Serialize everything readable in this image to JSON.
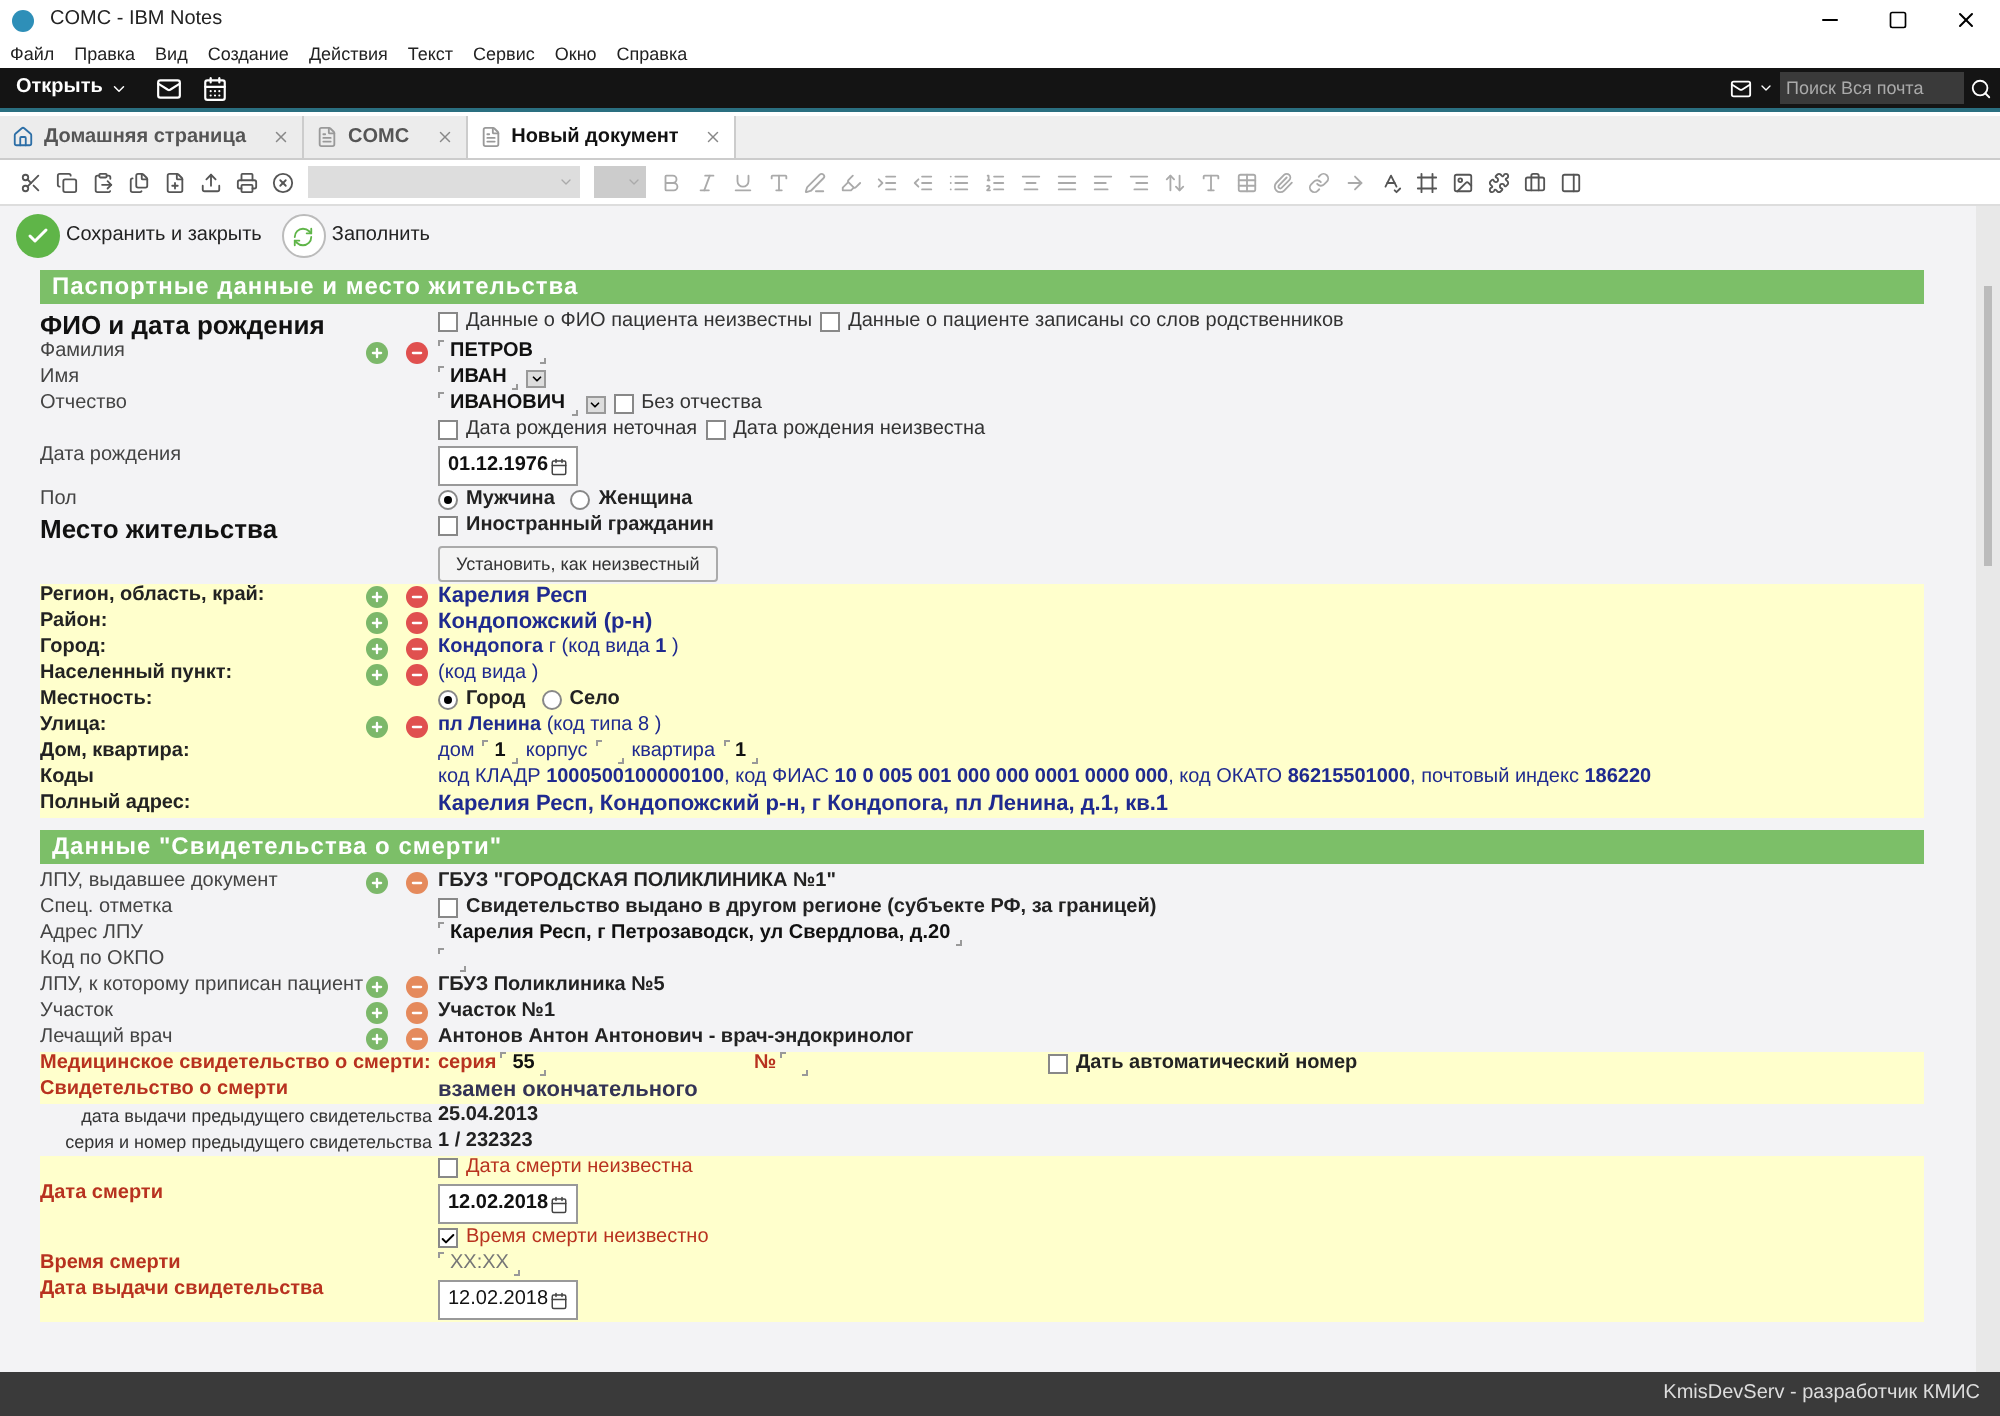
{
  "window": {
    "title": "COMC - IBM Notes"
  },
  "menu": [
    "Файл",
    "Правка",
    "Вид",
    "Создание",
    "Действия",
    "Текст",
    "Сервис",
    "Окно",
    "Справка"
  ],
  "topbar": {
    "open_label": "Открыть",
    "search_placeholder": "Поиск Вся почта"
  },
  "tabs": [
    {
      "label": "Домашняя страница",
      "kind": "home",
      "selected": false
    },
    {
      "label": "COMC",
      "kind": "doc",
      "selected": false
    },
    {
      "label": "Новый документ",
      "kind": "doc",
      "selected": true
    }
  ],
  "actions": [
    {
      "label": "Сохранить и закрыть",
      "kind": "save"
    },
    {
      "label": "Заполнить",
      "kind": "refresh"
    }
  ],
  "form": {
    "sections": [
      {
        "title": "Паспортные данные и место жительства",
        "rows": [
          {
            "kind": "heading",
            "label": "ФИО и дата рождения",
            "items": [
              {
                "kind": "checkbox",
                "label": "Данные о ФИО пациента неизвестны",
                "checked": false
              },
              {
                "kind": "checkbox",
                "label": "Данные о пациенте записаны со слов родственников",
                "checked": false
              }
            ]
          },
          {
            "kind": "field",
            "label": "Фамилия",
            "buttons": true,
            "items": [
              {
                "kind": "field",
                "value": "ПЕТРОВ"
              }
            ]
          },
          {
            "kind": "field",
            "label": "Имя",
            "items": [
              {
                "kind": "field",
                "value": "ИВАН"
              },
              {
                "kind": "dropdown"
              }
            ]
          },
          {
            "kind": "field",
            "label": "Отчество",
            "items": [
              {
                "kind": "field",
                "value": "ИВАНОВИЧ"
              },
              {
                "kind": "dropdown"
              },
              {
                "kind": "checkbox",
                "label": "Без отчества",
                "checked": false
              }
            ]
          },
          {
            "kind": "field",
            "items": [
              {
                "kind": "checkbox",
                "label": "Дата рождения неточная",
                "checked": false
              },
              {
                "kind": "checkbox",
                "label": "Дата рождения неизвестна",
                "checked": false
              }
            ]
          },
          {
            "kind": "field",
            "label": "Дата рождения",
            "items": [
              {
                "kind": "date",
                "value": "01.12.1976"
              }
            ]
          },
          {
            "kind": "field",
            "label": "Пол",
            "items": [
              {
                "kind": "radio",
                "label": "Мужчина",
                "selected": true
              },
              {
                "kind": "radio",
                "label": "Женщина",
                "selected": false
              }
            ]
          },
          {
            "kind": "heading",
            "label": "Место жительства",
            "items": [
              {
                "kind": "bold-checkbox",
                "label": "Иностранный гражданин",
                "checked": false
              }
            ]
          },
          {
            "kind": "field",
            "items": [
              {
                "kind": "button",
                "label": "Установить, как неизвестный"
              }
            ]
          },
          {
            "kind": "address",
            "label": "Регион, область, край:",
            "buttons": true,
            "items": [
              {
                "kind": "place",
                "text": "Карелия Респ"
              }
            ]
          },
          {
            "kind": "address",
            "label": "Район:",
            "buttons": true,
            "items": [
              {
                "kind": "place",
                "text": "Кондопожский (р-н)"
              }
            ]
          },
          {
            "kind": "address",
            "label": "Город:",
            "buttons": true,
            "items": [
              {
                "kind": "note",
                "text": "**Кондопога** г (код вида **1** )"
              }
            ]
          },
          {
            "kind": "address",
            "label": "Населенный пункт:",
            "buttons": true,
            "items": [
              {
                "kind": "note",
                "text": "(код вида  )"
              }
            ]
          },
          {
            "kind": "address",
            "label": "Местность:",
            "items": [
              {
                "kind": "radio",
                "label": "Город",
                "selected": true
              },
              {
                "kind": "radio",
                "label": "Село",
                "selected": false
              }
            ]
          },
          {
            "kind": "address",
            "label": "Улица:",
            "buttons": true,
            "items": [
              {
                "kind": "note",
                "text": "**пл Ленина** (код типа 8 )"
              }
            ]
          },
          {
            "kind": "address",
            "label": "Дом, квартира:",
            "items": [
              {
                "kind": "note",
                "text": "дом"
              },
              {
                "kind": "field",
                "value": "1"
              },
              {
                "kind": "note",
                "text": "корпус"
              },
              {
                "kind": "field"
              },
              {
                "kind": "note",
                "text": "квартира"
              },
              {
                "kind": "field",
                "value": "1"
              }
            ]
          },
          {
            "kind": "address",
            "label": "Коды",
            "items": [
              {
                "kind": "note",
                "text": "код КЛАДР **1000500100000100**, код ФИАС **10 0 005 001 000 000 0001 0000 000**, код ОКАТО **86215501000**, почтовый индекс **186220**"
              }
            ]
          },
          {
            "kind": "address",
            "label": "Полный адрес:",
            "items": [
              {
                "kind": "place",
                "text": "Карелия Респ, Кондопожский р-н, г Кондопога, пл Ленина, д.1, кв.1"
              }
            ]
          }
        ]
      },
      {
        "title": "Данные \"Свидетельства о смерти\"",
        "rows": [
          {
            "kind": "field",
            "label": "ЛПУ, выдавшее документ",
            "buttons": true,
            "items": [
              {
                "kind": "value",
                "text": "ГБУЗ \"ГОРОДСКАЯ ПОЛИКЛИНИКА №1\""
              }
            ]
          },
          {
            "kind": "field",
            "label": "Спец. отметка",
            "items": [
              {
                "kind": "bold-checkbox",
                "label": "Свидетельство выдано в другом регионе (субъекте РФ, за границей)",
                "checked": false
              }
            ]
          },
          {
            "kind": "field",
            "label": "Адрес ЛПУ",
            "items": [
              {
                "kind": "field",
                "value": "Карелия Респ, г Петрозаводск, ул Свердлова,  д.20"
              }
            ]
          },
          {
            "kind": "field",
            "label": "Код по ОКПО",
            "items": [
              {
                "kind": "field"
              }
            ]
          },
          {
            "kind": "field",
            "label": "ЛПУ, к которому приписан пациент",
            "buttons": true,
            "items": [
              {
                "kind": "value",
                "text": "ГБУЗ Поликлиника №5"
              }
            ]
          },
          {
            "kind": "field",
            "label": "Участок",
            "buttons": true,
            "items": [
              {
                "kind": "value",
                "text": "Участок №1"
              }
            ]
          },
          {
            "kind": "field",
            "label": "Лечащий врач",
            "buttons": true,
            "items": [
              {
                "kind": "value",
                "text": "Антонов Антон Антонович - врач-эндокринолог"
              }
            ]
          },
          {
            "kind": "death",
            "label": "Медицинское свидетельство о смерти:",
            "groups": [
              [
                {
                  "kind": "red-label",
                  "text": "серия"
                },
                {
                  "kind": "field",
                  "value": "55"
                }
              ],
              [
                {
                  "kind": "red-label",
                  "text": "№"
                },
                {
                  "kind": "field"
                }
              ],
              [
                {
                  "kind": "bold-checkbox",
                  "label": "Дать автоматический номер",
                  "checked": false
                }
              ]
            ]
          },
          {
            "kind": "death",
            "label": "Свидетельство о смерти",
            "items": [
              {
                "kind": "status",
                "text": "взамен окончательного"
              }
            ]
          },
          {
            "kind": "note",
            "label": "дата выдачи предыдущего свидетельства",
            "items": [
              {
                "kind": "value",
                "text": "25.04.2013"
              }
            ]
          },
          {
            "kind": "note",
            "label": "серия и номер предыдущего свидетельства",
            "items": [
              {
                "kind": "value",
                "text": "1 / 232323"
              }
            ]
          },
          {
            "kind": "death",
            "items": [
              {
                "kind": "red-checkbox",
                "label": "Дата смерти неизвестна",
                "checked": false
              }
            ]
          },
          {
            "kind": "death",
            "label": "Дата смерти",
            "items": [
              {
                "kind": "date",
                "value": "12.02.2018"
              }
            ]
          },
          {
            "kind": "death",
            "items": [
              {
                "kind": "red-checkbox",
                "label": "Время смерти неизвестно",
                "checked": true
              }
            ]
          },
          {
            "kind": "death",
            "label": "Время смерти",
            "items": [
              {
                "kind": "field",
                "placeholder": "XX:XX"
              }
            ]
          },
          {
            "kind": "death",
            "label": "Дата выдачи свидетельства",
            "items": [
              {
                "kind": "plain-date",
                "value": "12.02.2018"
              }
            ]
          }
        ]
      }
    ]
  },
  "status_bar": {
    "text": "KmisDevServ - разработчик КМИС"
  }
}
